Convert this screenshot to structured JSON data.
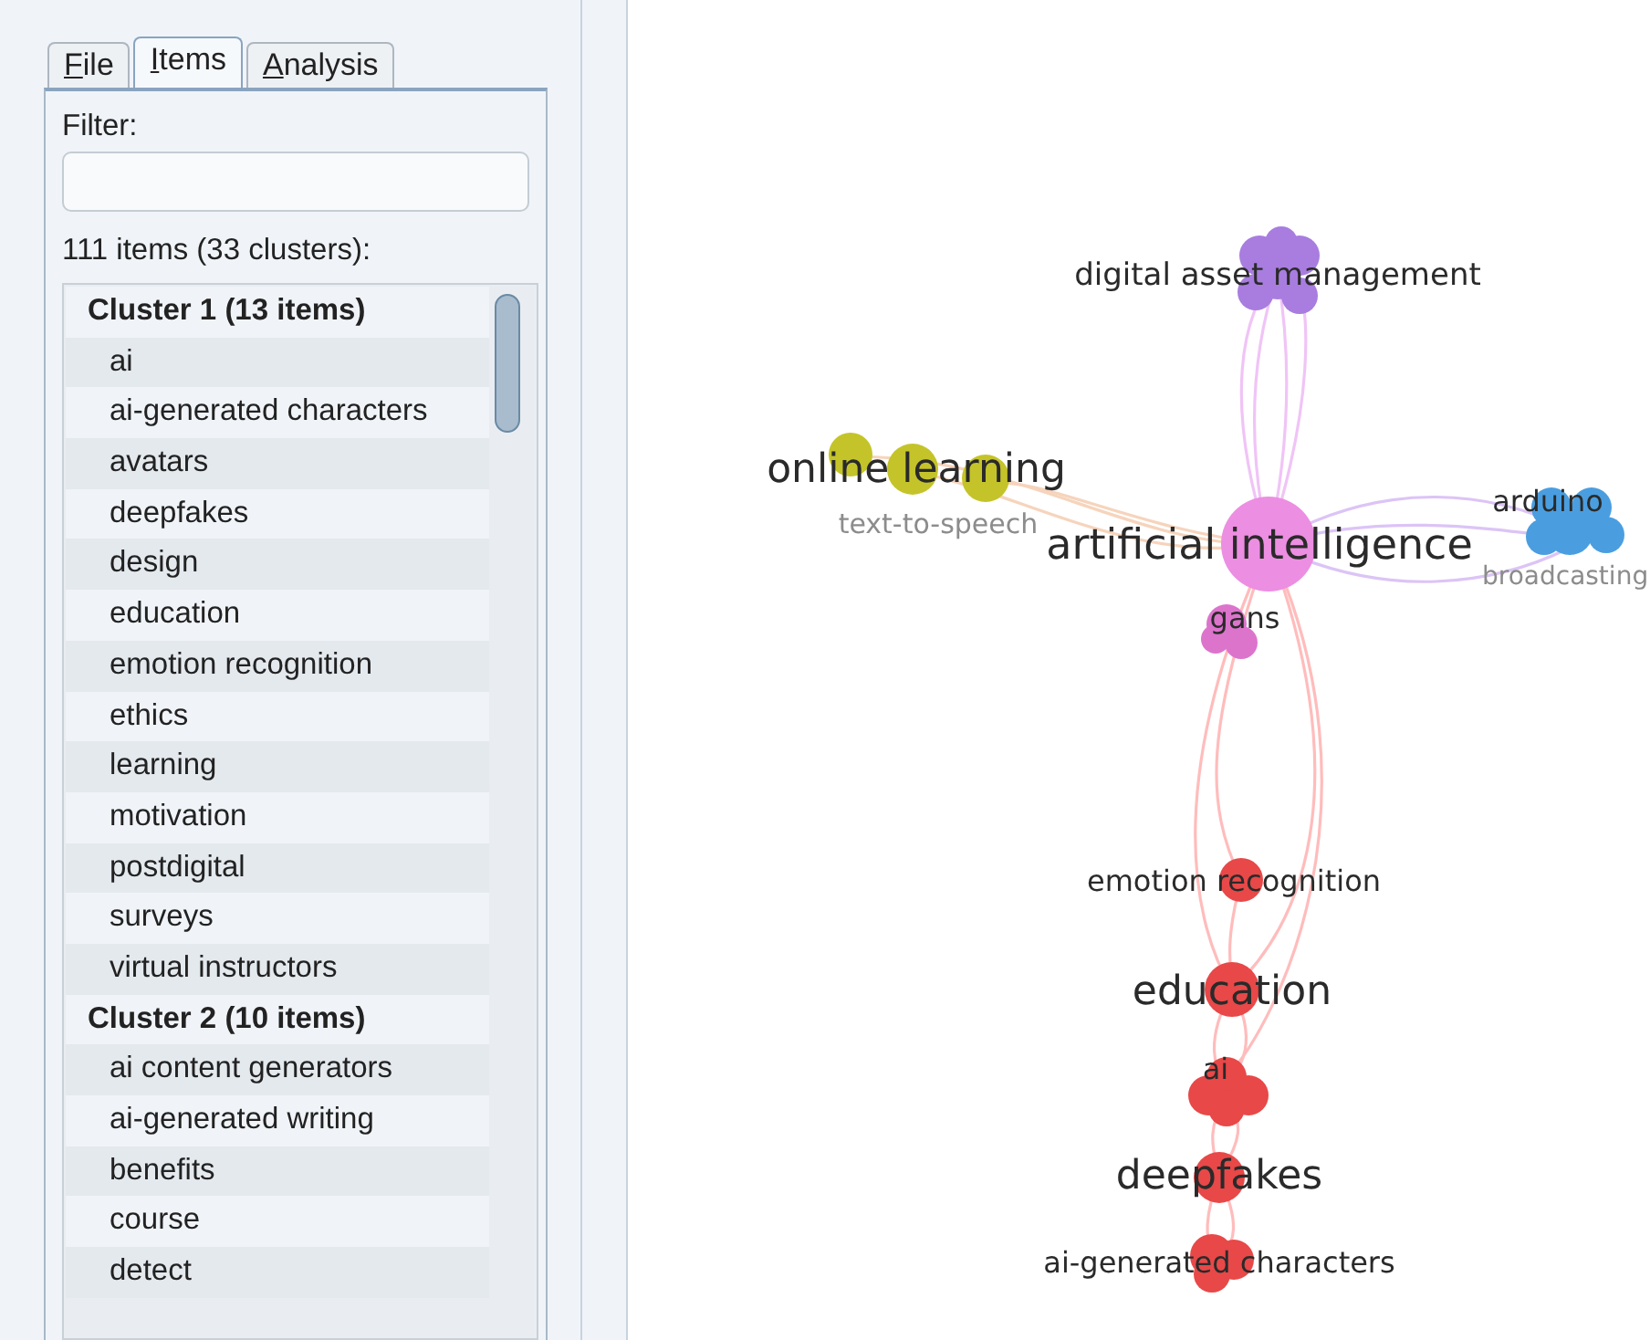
{
  "tabs": [
    {
      "label": "File",
      "selected": false
    },
    {
      "label": "Items",
      "selected": true
    },
    {
      "label": "Analysis",
      "selected": false
    }
  ],
  "filter": {
    "label": "Filter:"
  },
  "items_count": "111 items (33 clusters):",
  "clusters": [
    {
      "label": "Cluster 1 (13 items)",
      "children": [
        {
          "label": "ai"
        },
        {
          "label": "ai-generated characters"
        },
        {
          "label": "avatars"
        },
        {
          "label": "deepfakes"
        },
        {
          "label": "design"
        },
        {
          "label": "education"
        },
        {
          "label": "emotion recognition"
        },
        {
          "label": "ethics"
        },
        {
          "label": "learning"
        },
        {
          "label": "motivation"
        },
        {
          "label": "postdigital"
        },
        {
          "label": "surveys"
        },
        {
          "label": "virtual instructors"
        }
      ]
    },
    {
      "label": "Cluster 2 (10 items)",
      "children": [
        {
          "label": "ai content generators"
        },
        {
          "label": "ai-generated writing"
        },
        {
          "label": "benefits"
        },
        {
          "label": "course"
        },
        {
          "label": "detect"
        }
      ]
    }
  ],
  "network": {
    "nodes": [
      {
        "label": "digital asset management",
        "color": "#a87ddf",
        "faded": false
      },
      {
        "label": "online learning",
        "color": "#c4c42a",
        "faded": false
      },
      {
        "label": "text-to-speech",
        "faded": true
      },
      {
        "label": "artificial intelligence",
        "color": "#ec8ee2",
        "faded": false
      },
      {
        "label": "arduino",
        "color": "#4a9ee0",
        "faded": false
      },
      {
        "label": "broadcasting",
        "faded": true
      },
      {
        "label": "gans",
        "color": "#dc74cc",
        "faded": false
      },
      {
        "label": "emotion recognition",
        "color": "#e84848",
        "faded": false
      },
      {
        "label": "education",
        "color": "#e84848",
        "faded": false
      },
      {
        "label": "ai",
        "color": "#e84848",
        "faded": false
      },
      {
        "label": "deepfakes",
        "color": "#e84848",
        "faded": false
      },
      {
        "label": "ai-generated characters",
        "color": "#e84848",
        "faded": false
      }
    ]
  }
}
